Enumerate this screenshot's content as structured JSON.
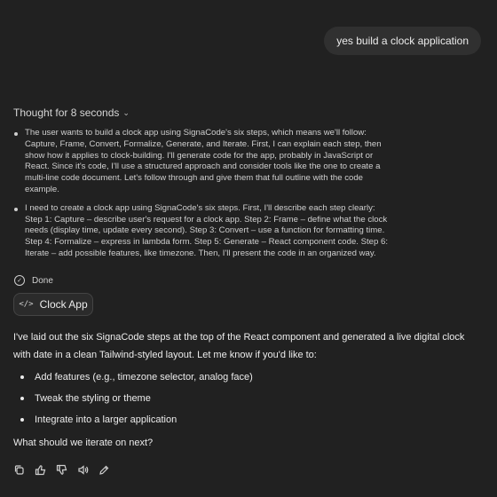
{
  "user_message": "yes build a clock application",
  "thought": {
    "toggle_label": "Thought for 8 seconds",
    "items": [
      "The user wants to build a clock app using SignaCode's six steps, which means we'll follow: Capture, Frame, Convert, Formalize, Generate, and Iterate. First, I can explain each step, then show how it applies to clock-building. I'll generate code for the app, probably in JavaScript or React. Since it's code, I'll use a structured approach and consider tools like the one to create a multi-line code document. Let's follow through and give them that full outline with the code example.",
      "I need to create a clock app using SignaCode's six steps. First, I'll describe each step clearly: Step 1: Capture – describe user's request for a clock app. Step 2: Frame – define what the clock needs (display time, update every second). Step 3: Convert – use a function for formatting time. Step 4: Formalize – express in lambda form. Step 5: Generate – React component code. Step 6: Iterate – add possible features, like timezone. Then, I'll present the code in an organized way."
    ],
    "done_label": "Done"
  },
  "canvas": {
    "label": "Clock App",
    "icon": "code-icon"
  },
  "response": {
    "intro": "I've laid out the six SignaCode steps at the top of the React component and generated a live digital clock with date in a clean Tailwind-styled layout. Let me know if you'd like to:",
    "bullets": [
      "Add features (e.g., timezone selector, analog face)",
      "Tweak the styling or theme",
      "Integrate into a larger application"
    ],
    "closing": "What should we iterate on next?"
  },
  "actions": [
    "copy-icon",
    "thumbs-up-icon",
    "thumbs-down-icon",
    "read-aloud-icon",
    "edit-icon"
  ]
}
